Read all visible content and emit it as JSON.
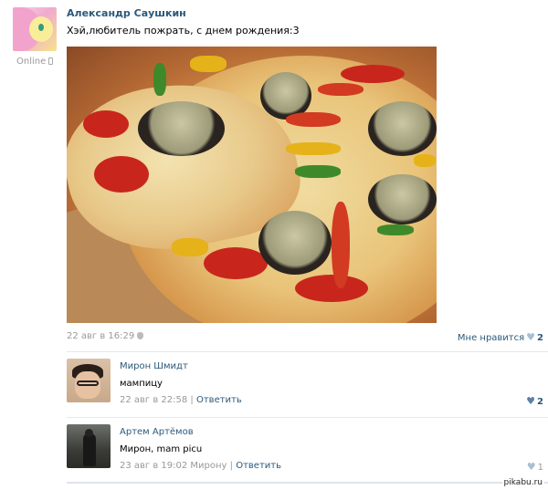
{
  "post": {
    "author": "Александр Саушкин",
    "status": "Online",
    "text": "Хэй,любитель пожрать, с днем рождения:3",
    "date": "22 авг в 16:29",
    "like_label": "Мне нравится",
    "like_count": "2"
  },
  "comments": [
    {
      "name": "Мирон Шмидт",
      "text": "мампицу",
      "date": "22 авг в 22:58",
      "separator": " | ",
      "reply": "Ответить",
      "likes": "2"
    },
    {
      "name": "Артем Артёмов",
      "text": "Мирон, mam picu",
      "date": "23 авг в 19:02 Мирону",
      "separator": " | ",
      "reply": "Ответить",
      "likes": "1"
    }
  ],
  "watermark": "pikabu.ru",
  "colors": {
    "link": "#2b587a",
    "meta": "#999999",
    "heart": "#a8bfd3"
  }
}
